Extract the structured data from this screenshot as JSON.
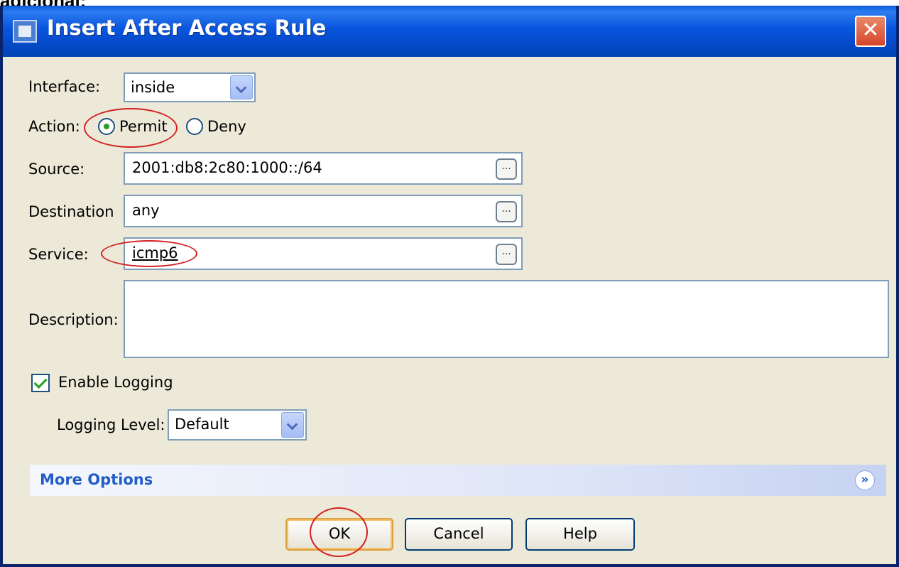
{
  "page_caption": "adicional:",
  "dialog": {
    "title": "Insert After Access Rule",
    "close_symbol": "✕"
  },
  "form": {
    "interface_label": "Interface:",
    "interface_value": "inside",
    "action_label": "Action:",
    "action_permit_label": "Permit",
    "action_deny_label": "Deny",
    "action_selected": "Permit",
    "source_label": "Source:",
    "source_value": "2001:db8:2c80:1000::/64",
    "destination_label": "Destination",
    "destination_value": "any",
    "service_label": "Service:",
    "service_value": "icmp6",
    "description_label": "Description:",
    "description_value": "",
    "browse_symbol": "...",
    "enable_logging_label": "Enable Logging",
    "enable_logging_checked": true,
    "logging_level_label": "Logging Level:",
    "logging_level_value": "Default"
  },
  "more_options": {
    "label": "More Options",
    "toggle_symbol": "»"
  },
  "buttons": {
    "ok": "OK",
    "cancel": "Cancel",
    "help": "Help"
  },
  "icons": [
    "dialog-app-icon",
    "close-icon",
    "chevron-down-icon",
    "expand-icon"
  ]
}
